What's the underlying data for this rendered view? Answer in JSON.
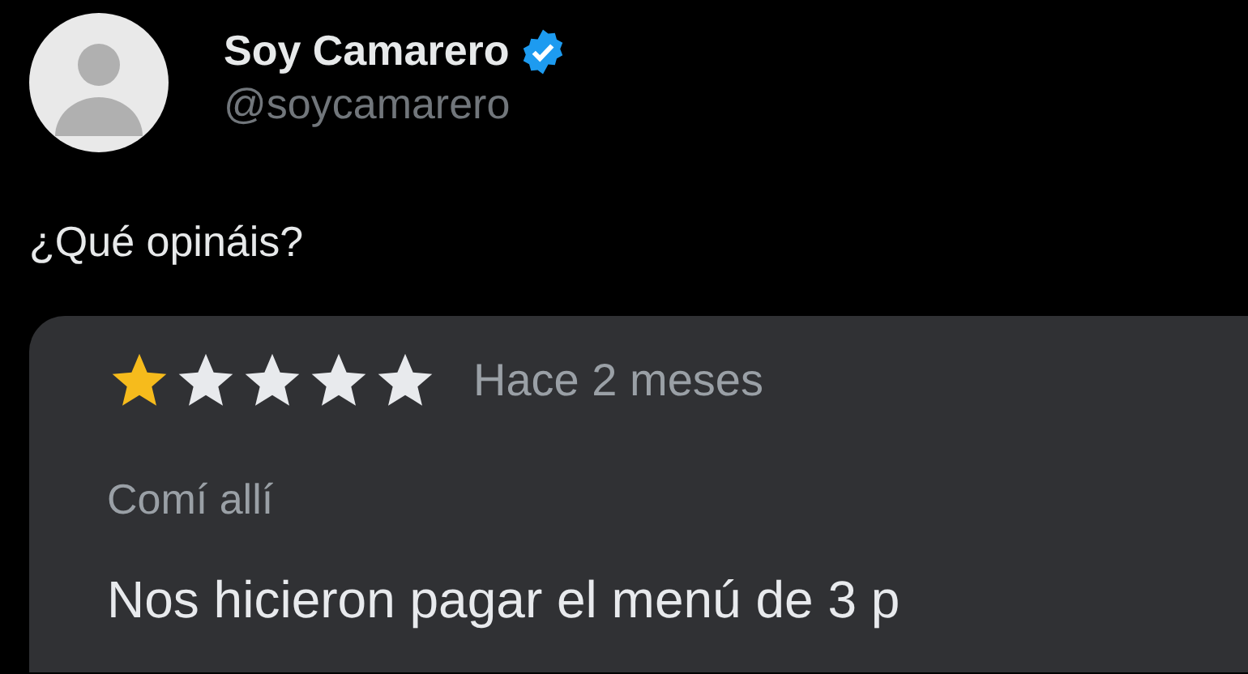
{
  "author": {
    "name": "Soy Camarero",
    "verified": true,
    "handle": "@soycamarero"
  },
  "tweet_text": "¿Qué opináis?",
  "review": {
    "stars": 1,
    "time": "Hace 2 meses",
    "context": "Comí allí",
    "text": "Nos hicieron pagar el menú de 3 p"
  }
}
